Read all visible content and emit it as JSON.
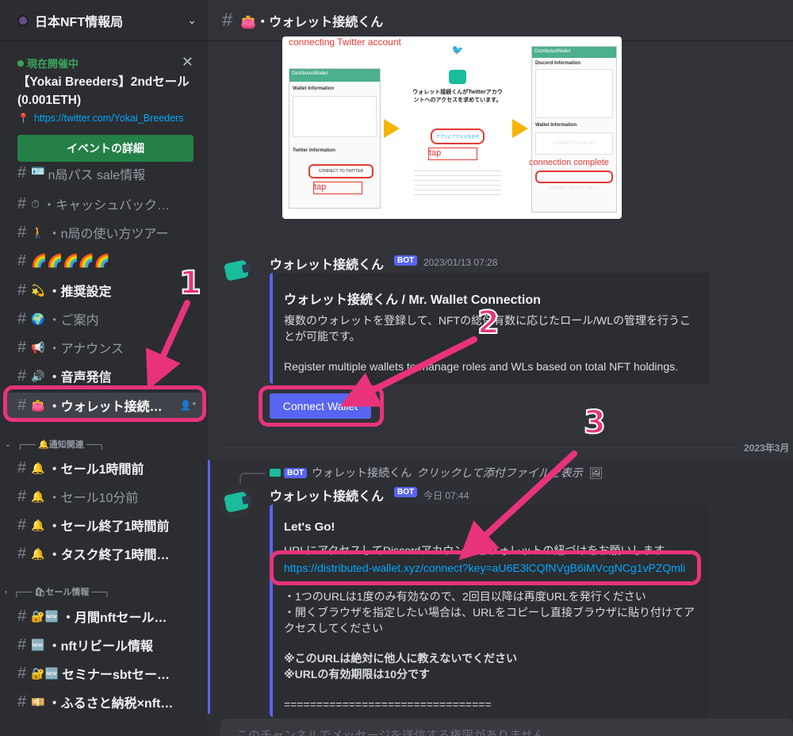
{
  "server": {
    "name": "日本NFT情報局"
  },
  "event": {
    "status": "現在開催中",
    "title": "【Yokai Breeders】2ndセール(0.001ETH)",
    "link": "https://twitter.com/Yokai_Breeders",
    "button": "イベントの詳細"
  },
  "channels": [
    {
      "emoji": "🪪",
      "name": "n局パス sale情報"
    },
    {
      "emoji": "⏱",
      "name": "キャッシュバック…"
    },
    {
      "emoji": "🚶",
      "name": "n局の使い方ツアー"
    },
    {
      "emoji": "",
      "name": "🌈🌈🌈🌈🌈"
    },
    {
      "emoji": "💫",
      "name": "推奨設定"
    },
    {
      "emoji": "🌍",
      "name": "ご案内"
    },
    {
      "emoji": "📢",
      "name": "アナウンス"
    },
    {
      "emoji": "🔊",
      "name": "音声発信"
    },
    {
      "emoji": "👛",
      "name": "ウォレット接続…"
    }
  ],
  "categories": [
    {
      "label": "┌── 🔔通知関連 ──┐"
    },
    {
      "label": "┌── 🛍セール情報 ──┐"
    }
  ],
  "channels2": [
    {
      "emoji": "🔔",
      "name": "セール1時間前"
    },
    {
      "emoji": "🔔",
      "name": "セール10分前"
    },
    {
      "emoji": "🔔",
      "name": "セール終了1時間前"
    },
    {
      "emoji": "🔔",
      "name": "タスク終了1時間…"
    }
  ],
  "channels3": [
    {
      "emoji": "🔐🆕",
      "name": "月間nftセール…"
    },
    {
      "emoji": "🆕",
      "name": "nftリビール情報"
    },
    {
      "emoji": "🔐🆕",
      "name": "セミナーsbtセー…"
    },
    {
      "emoji": "💴",
      "name": "ふるさと納税×nft…"
    }
  ],
  "topbar": {
    "title": "👛・ウォレット接続くん"
  },
  "image": {
    "caption_top": "connecting Twitter account",
    "left_header": "DistributedWallet",
    "left_wallet": "Wallet Information",
    "left_twitter": "Twitter Information",
    "left_btn": "CONNECT TO TWITTER",
    "left_tap": "tap",
    "mid_text": "ウォレット接続くんがTwitterアカウントへのアクセスを求めています。",
    "mid_btn": "アプリにアクセスを許可",
    "mid_tap": "tap",
    "right_header": "DistributedWallet",
    "right_discord": "Discord Information",
    "right_wallet": "Wallet Information",
    "right_connect": "CONNECT TO WALLET",
    "right_complete": "connection complete",
    "right_btn": "CONNECT TO TWITTER"
  },
  "msg1": {
    "user": "ウォレット接続くん",
    "bot": "BOT",
    "time": "2023/01/13 07:28",
    "embed_title": "ウォレット接続くん / Mr. Wallet Connection",
    "embed_text": "複数のウォレットを登録して、NFTの総保有数に応じたロール/WLの管理を行うことが可能です。",
    "embed_text_en": "Register multiple wallets to manage roles and WLs based on total NFT holdings.",
    "button": "Connect Wallet"
  },
  "divider_date": "2023年3月",
  "msg2": {
    "reply_user": "ウォレット接続くん",
    "reply_bot": "BOT",
    "reply_text": "クリックして添付ファイルを表示",
    "user": "ウォレット接続くん",
    "bot": "BOT",
    "time": "今日 07:44",
    "title": "Let's Go!",
    "line1": "URLにアクセスしてDiscordアカウントとウォレットの紐づけをお願いします",
    "link": "https://distributed-wallet.xyz/connect?key=aU6E3lCQfNVgB6iMVcgNCg1vPZQmli",
    "bullet1": "・1つのURLは1度のみ有効なので、2回目以降は再度URLを発行ください",
    "bullet2": "・開くブラウザを指定したい場合は、URLをコピーし直接ブラウザに貼り付けてアクセスしてください",
    "warn1": "※このURLは絶対に他人に教えないでください",
    "warn2": "※URLの有効期限は10分です",
    "sep": "================================"
  },
  "input": {
    "placeholder": "このチャンネルでメッセージを送信する権限がありません。"
  },
  "annotations": {
    "n1": "1",
    "n2": "2",
    "n3": "3"
  }
}
